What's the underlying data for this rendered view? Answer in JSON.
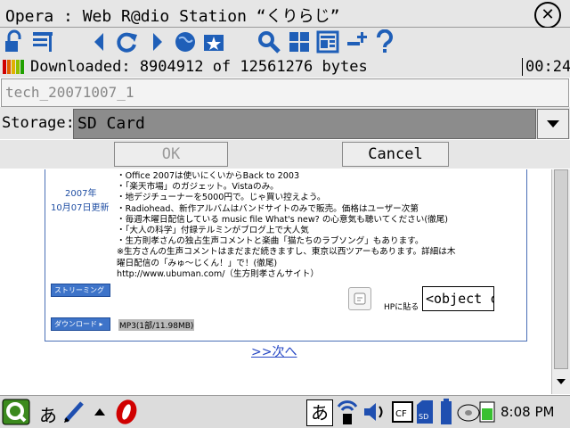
{
  "window": {
    "title": "Opera : Web R@dio Station “くりらじ”"
  },
  "download": {
    "status": "Downloaded: 8904912 of 12561276 bytes",
    "progress_fraction": 0.709,
    "elapsed": "00:24",
    "filename": "tech_20071007_1"
  },
  "storage": {
    "label": "Storage:",
    "value": "SD Card"
  },
  "dialog": {
    "ok_label": "OK",
    "cancel_label": "Cancel"
  },
  "page": {
    "date_line1": "2007年",
    "date_line2": "10月07日更新",
    "news_lines": [
      "・Office 2007は使いにくいからBack to 2003",
      "・「楽天市場」のガジェット。Vistaのみ。",
      "・地デジチューナーを5000円で。じゃ買い控えよう。",
      "・Radiohead、新作アルバムはバンドサイトのみで販売。価格はユーザー次第",
      "・毎週木曜日配信している music file What's new? の心意気も聴いてください(徹尾)",
      "・「大人の科学」付録テルミンがブログ上で大人気",
      "・生方則孝さんの独占生声コメントと楽曲「猫たちのラブソング」もあります。",
      "※生方さんの生声コメントはまだまだ続きますし、東京以西ツアーもあります。詳細は木",
      "曜日配信の「みゅ～じくん！」で！(徹尾)",
      "http://www.ubuman.com/（生方則孝さんサイト）"
    ],
    "streaming_label": "ストリーミング",
    "download_label": "ダウンロード",
    "mp3_label": "MP3(1部/11.98MB)",
    "hp_label": "HPに貼る",
    "embed_value": "<object cl",
    "next_link": ">>次へ"
  },
  "taskbar": {
    "ime_left": "あ",
    "ime_right": "あ",
    "clock": "8:08 PM"
  },
  "icons": {
    "toolbar": [
      "lock-icon",
      "bookmark-list-icon",
      "back-icon",
      "reload-icon",
      "forward-icon",
      "globe-icon",
      "bookmark-star-icon",
      "search-icon",
      "grid-view-icon",
      "page-view-icon",
      "zoom-icon",
      "help-icon"
    ]
  },
  "colors": {
    "accent_blue": "#3e74c9",
    "link_blue": "#2446c4",
    "chrome_gray": "#e6e6e6"
  }
}
